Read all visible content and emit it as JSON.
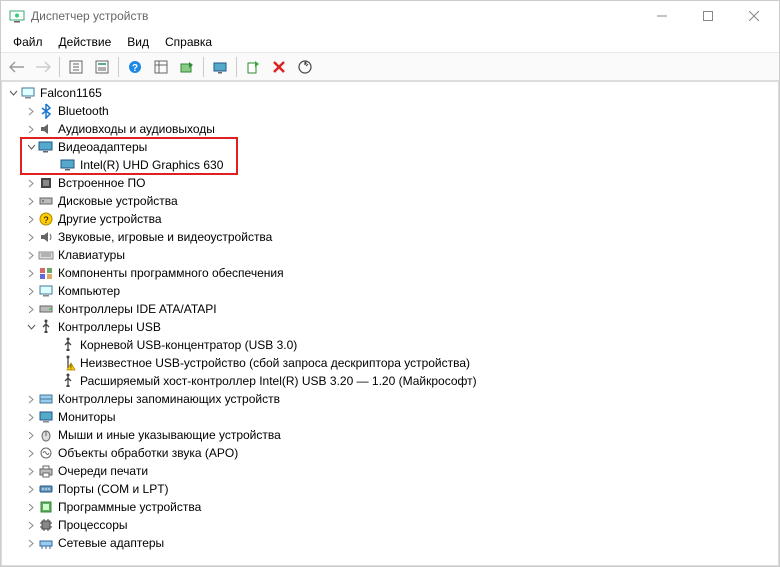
{
  "window": {
    "title": "Диспетчер устройств"
  },
  "menu": {
    "file": "Файл",
    "action": "Действие",
    "view": "Вид",
    "help": "Справка"
  },
  "tree": {
    "root": "Falcon1165",
    "bluetooth": "Bluetooth",
    "audio": "Аудиовходы и аудиовыходы",
    "video": "Видеоадаптеры",
    "video_child": "Intel(R) UHD Graphics 630",
    "firmware": "Встроенное ПО",
    "disk": "Дисковые устройства",
    "other": "Другие устройства",
    "sound": "Звуковые, игровые и видеоустройства",
    "keyboard": "Клавиатуры",
    "software": "Компоненты программного обеспечения",
    "computer": "Компьютер",
    "ide": "Контроллеры IDE ATA/ATAPI",
    "usb": "Контроллеры USB",
    "usb_child1": "Корневой USB-концентратор (USB 3.0)",
    "usb_child2": "Неизвестное USB-устройство (сбой запроса дескриптора устройства)",
    "usb_child3": "Расширяемый хост-контроллер Intel(R) USB 3.20 — 1.20 (Майкрософт)",
    "memctrl": "Контроллеры запоминающих устройств",
    "monitors": "Мониторы",
    "mice": "Мыши и иные указывающие устройства",
    "apo": "Объекты обработки звука (APO)",
    "printq": "Очереди печати",
    "ports": "Порты (COM и LPT)",
    "swdev": "Программные устройства",
    "cpu": "Процессоры",
    "net": "Сетевые адаптеры"
  }
}
